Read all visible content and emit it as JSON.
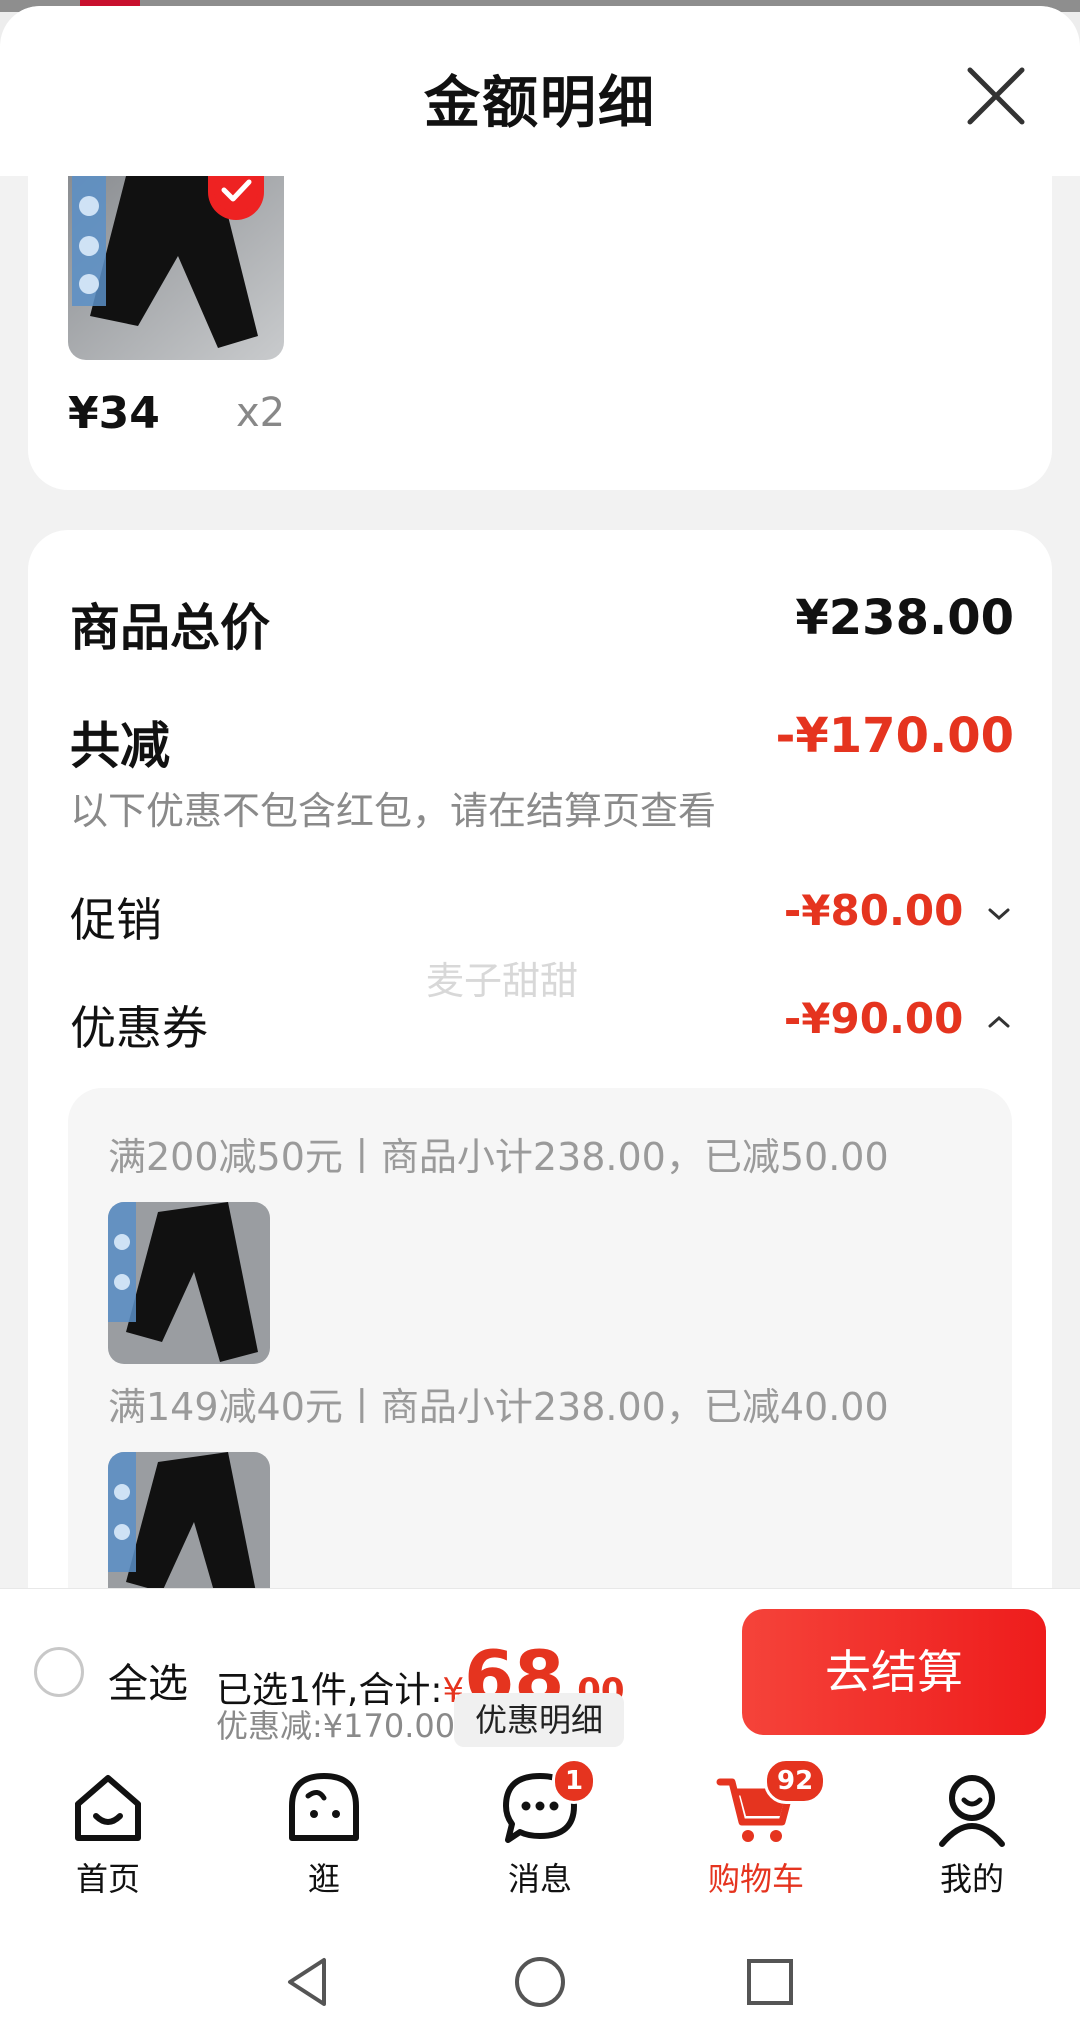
{
  "sheet": {
    "title": "金额明细"
  },
  "selected_item": {
    "price": "¥34",
    "quantity": "x2"
  },
  "summary": {
    "total_label": "商品总价",
    "total_value": "¥238.00",
    "reduce_label": "共减",
    "reduce_value": "-¥170.00",
    "note": "以下优惠不包含红包，请在结算页查看",
    "promo_label": "促销",
    "promo_value": "-¥80.00",
    "coupon_label": "优惠券",
    "coupon_value": "-¥90.00"
  },
  "coupons": [
    {
      "text": "满200减50元丨商品小计238.00，已减50.00"
    },
    {
      "text": "满149减40元丨商品小计238.00，已减40.00"
    }
  ],
  "watermark": "麦子甜甜",
  "checkout": {
    "select_all": "全选",
    "selected_label": "已选1件,合计:",
    "currency": "¥",
    "total_int": "68",
    "total_dec": ".00",
    "discount": "优惠减:¥170.00",
    "detail_button": "优惠明细",
    "checkout_button": "去结算"
  },
  "tabbar": {
    "items": [
      {
        "label": "首页"
      },
      {
        "label": "逛"
      },
      {
        "label": "消息",
        "badge": "1"
      },
      {
        "label": "购物车",
        "badge": "92"
      },
      {
        "label": "我的"
      }
    ]
  },
  "icons": {
    "close": "close-icon",
    "check": "check-icon",
    "chevron_down": "chevron-down-icon",
    "chevron_up": "chevron-up-icon",
    "home": "home-icon",
    "browse": "browse-icon",
    "message": "message-icon",
    "cart": "cart-icon",
    "profile": "profile-icon",
    "back": "back-icon",
    "home_nav": "home-nav-icon",
    "recent": "recent-icon"
  },
  "colors": {
    "accent": "#e5341f",
    "checkout_button": "#f5433a"
  }
}
